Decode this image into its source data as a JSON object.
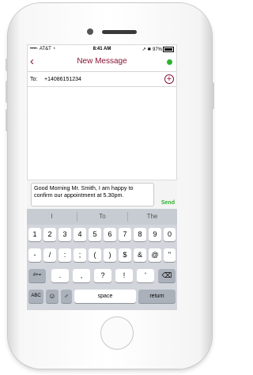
{
  "status": {
    "carrier": "••••◦ AT&T ◔",
    "time": "8:41 AM",
    "right": "↗ ✱ 97%"
  },
  "nav": {
    "back": "‹",
    "title": "New Message",
    "indicator_color": "#2db22d"
  },
  "to": {
    "label": "To:",
    "number": "+14086151234",
    "add": "+"
  },
  "compose": {
    "message": "Good Morning Mr. Smith, I am happy to confirm our appointment at 5.30pm.",
    "send": "Send"
  },
  "predictions": [
    "I",
    "To",
    "The"
  ],
  "keyboard": {
    "row1": [
      "1",
      "2",
      "3",
      "4",
      "5",
      "6",
      "7",
      "8",
      "9",
      "0"
    ],
    "row2": [
      "-",
      "/",
      ":",
      ";",
      "(",
      ")",
      "$",
      "&",
      "@",
      "\""
    ],
    "row3": {
      "shift": "#+=",
      "keys": [
        ".",
        ",",
        "?",
        "!",
        "'"
      ],
      "delete": "⌫"
    },
    "row4": {
      "abc": "ABC",
      "emoji": "☺",
      "mic": "♂",
      "space": "space",
      "return": "return"
    }
  },
  "colors": {
    "accent": "#8a1538",
    "green": "#2db22d"
  }
}
